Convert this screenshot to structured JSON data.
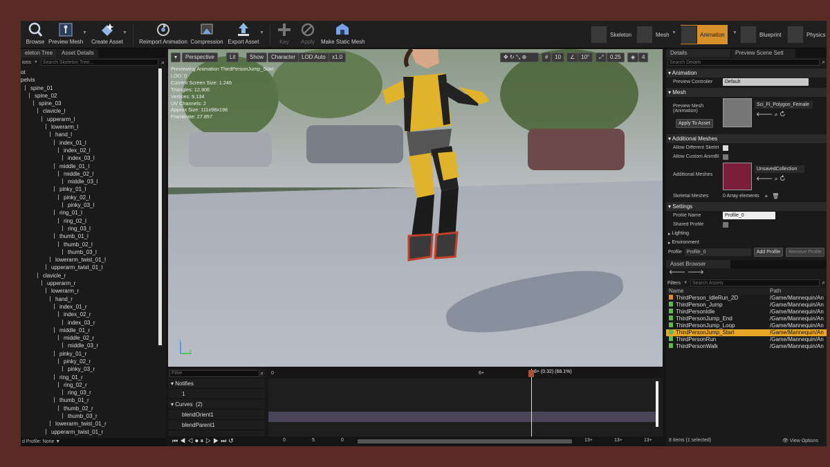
{
  "toolbar": {
    "buttons": [
      {
        "label": "Browse",
        "icon": "browse-icon"
      },
      {
        "label": "Preview Mesh",
        "icon": "preview-mesh-icon"
      },
      {
        "label": "Create Asset",
        "icon": "create-asset-icon"
      },
      {
        "label": "Reimport Animation",
        "icon": "reimport-icon"
      },
      {
        "label": "Compression",
        "icon": "compression-icon"
      },
      {
        "label": "Export Asset",
        "icon": "export-icon"
      },
      {
        "label": "Key",
        "icon": "plus-icon"
      },
      {
        "label": "Apply",
        "icon": "apply-icon"
      },
      {
        "label": "Make Static Mesh",
        "icon": "static-mesh-icon"
      }
    ],
    "modes": [
      {
        "label": "Skeleton"
      },
      {
        "label": "Mesh"
      },
      {
        "label": "Animation"
      },
      {
        "label": "Blueprint"
      },
      {
        "label": "Physics"
      }
    ]
  },
  "left": {
    "tabs": [
      "eleton Tree",
      "Asset Details"
    ],
    "options_label": "ions",
    "search_placeholder": "Search Skeleton Tree...",
    "bones": [
      {
        "n": "ot",
        "d": 0
      },
      {
        "n": "pelvis",
        "d": 0
      },
      {
        "n": "spine_01",
        "d": 1
      },
      {
        "n": "spine_02",
        "d": 2
      },
      {
        "n": "spine_03",
        "d": 3
      },
      {
        "n": "clavicle_l",
        "d": 4
      },
      {
        "n": "upperarm_l",
        "d": 5
      },
      {
        "n": "lowerarm_l",
        "d": 6
      },
      {
        "n": "hand_l",
        "d": 7
      },
      {
        "n": "index_01_l",
        "d": 8
      },
      {
        "n": "index_02_l",
        "d": 9
      },
      {
        "n": "index_03_l",
        "d": 10
      },
      {
        "n": "middle_01_l",
        "d": 8
      },
      {
        "n": "middle_02_l",
        "d": 9
      },
      {
        "n": "middle_03_l",
        "d": 10
      },
      {
        "n": "pinky_01_l",
        "d": 8
      },
      {
        "n": "pinky_02_l",
        "d": 9
      },
      {
        "n": "pinky_03_l",
        "d": 10
      },
      {
        "n": "ring_01_l",
        "d": 8
      },
      {
        "n": "ring_02_l",
        "d": 9
      },
      {
        "n": "ring_03_l",
        "d": 10
      },
      {
        "n": "thumb_01_l",
        "d": 8
      },
      {
        "n": "thumb_02_l",
        "d": 9
      },
      {
        "n": "thumb_03_l",
        "d": 10
      },
      {
        "n": "lowerarm_twist_01_l",
        "d": 7
      },
      {
        "n": "upperarm_twist_01_l",
        "d": 6
      },
      {
        "n": "clavicle_r",
        "d": 4
      },
      {
        "n": "upperarm_r",
        "d": 5
      },
      {
        "n": "lowerarm_r",
        "d": 6
      },
      {
        "n": "hand_r",
        "d": 7
      },
      {
        "n": "index_01_r",
        "d": 8
      },
      {
        "n": "index_02_r",
        "d": 9
      },
      {
        "n": "index_03_r",
        "d": 10
      },
      {
        "n": "middle_01_r",
        "d": 8
      },
      {
        "n": "middle_02_r",
        "d": 9
      },
      {
        "n": "middle_03_r",
        "d": 10
      },
      {
        "n": "pinky_01_r",
        "d": 8
      },
      {
        "n": "pinky_02_r",
        "d": 9
      },
      {
        "n": "pinky_03_r",
        "d": 10
      },
      {
        "n": "ring_01_r",
        "d": 8
      },
      {
        "n": "ring_02_r",
        "d": 9
      },
      {
        "n": "ring_03_r",
        "d": 10
      },
      {
        "n": "thumb_01_r",
        "d": 8
      },
      {
        "n": "thumb_02_r",
        "d": 9
      },
      {
        "n": "thumb_03_r",
        "d": 10
      },
      {
        "n": "lowerarm_twist_01_r",
        "d": 7
      },
      {
        "n": "upperarm_twist_01_r",
        "d": 6
      }
    ],
    "footer": "d Profile: None"
  },
  "viewport": {
    "buttons": [
      "Perspective",
      "Lit",
      "Show",
      "Character",
      "LOD Auto",
      "x1.0"
    ],
    "snap": {
      "grid": "10",
      "rot": "10°",
      "scale": "0.25",
      "cam": "4"
    },
    "info": [
      "Previewing Animation ThirdPersonJump_Start",
      "LOD: 0",
      "Current Screen Size: 1.246",
      "Triangles: 12,906",
      "Vertices: 9,134",
      "UV Channels: 2",
      "Approx Size: 111x98x198",
      "Framerate: 27.857"
    ]
  },
  "timeline": {
    "filter_placeholder": "Filter",
    "notifies_label": "Notifies",
    "notify_track": "1",
    "curves_label": "Curves",
    "curves_count": "(2)",
    "curves": [
      "blendOrient1",
      "blendParent1"
    ],
    "ruler_start": "0",
    "ruler_mid": "6+",
    "playhead": "8+ (0.32) (68.1%)",
    "footer_nums": [
      "0",
      "5",
      "0",
      "13+",
      "13+",
      "13+"
    ]
  },
  "right": {
    "tabs": [
      "Details",
      "Preview Scene Sett"
    ],
    "search_placeholder": "Search Details",
    "animation_label": "Animation",
    "preview_controller_label": "Preview Controller",
    "preview_controller_value": "Default",
    "mesh_label": "Mesh",
    "preview_mesh_label": "Preview Mesh (Animation)",
    "preview_mesh_value": "Sci_Fi_Polygon_Female",
    "apply_to_asset": "Apply To Asset",
    "additional_meshes_label": "Additional Meshes",
    "allow_diff_skel": "Allow Different Skelet",
    "allow_custom": "Allow Custom AnimBl",
    "additional_meshes_prop": "Additional Meshes",
    "collection_value": "UnsavedCollection",
    "skeletal_meshes_label": "Skeletal Meshes",
    "array_elements": "0 Array elements",
    "settings_label": "Settings",
    "profile_name_label": "Profile Name",
    "profile_name_value": "Profile_0",
    "shared_profile_label": "Shared Profile",
    "lighting_label": "Lighting",
    "environment_label": "Environment",
    "profile_label": "Profile",
    "profile_value": "Profile_0",
    "add_profile": "Add Profile",
    "remove_profile": "Remove Profile",
    "asset_browser_tab": "Asset Browser",
    "filters_label": "Filters",
    "asset_search_placeholder": "Search Assets",
    "col_name": "Name",
    "col_path": "Path",
    "assets": [
      {
        "name": "ThirdPerson_IdleRun_2D",
        "path": "/Game/Mannequin/An"
      },
      {
        "name": "ThirdPerson_Jump",
        "path": "/Game/Mannequin/An"
      },
      {
        "name": "ThirdPersonIdle",
        "path": "/Game/Mannequin/An"
      },
      {
        "name": "ThirdPersonJump_End",
        "path": "/Game/Mannequin/An"
      },
      {
        "name": "ThirdPersonJump_Loop",
        "path": "/Game/Mannequin/An"
      },
      {
        "name": "ThirdPersonJump_Start",
        "path": "/Game/Mannequin/An"
      },
      {
        "name": "ThirdPersonRun",
        "path": "/Game/Mannequin/An"
      },
      {
        "name": "ThirdPersonWalk",
        "path": "/Game/Mannequin/An"
      }
    ],
    "selected_asset_index": 5,
    "status": "8 items (1 selected)",
    "view_options": "View Options"
  }
}
